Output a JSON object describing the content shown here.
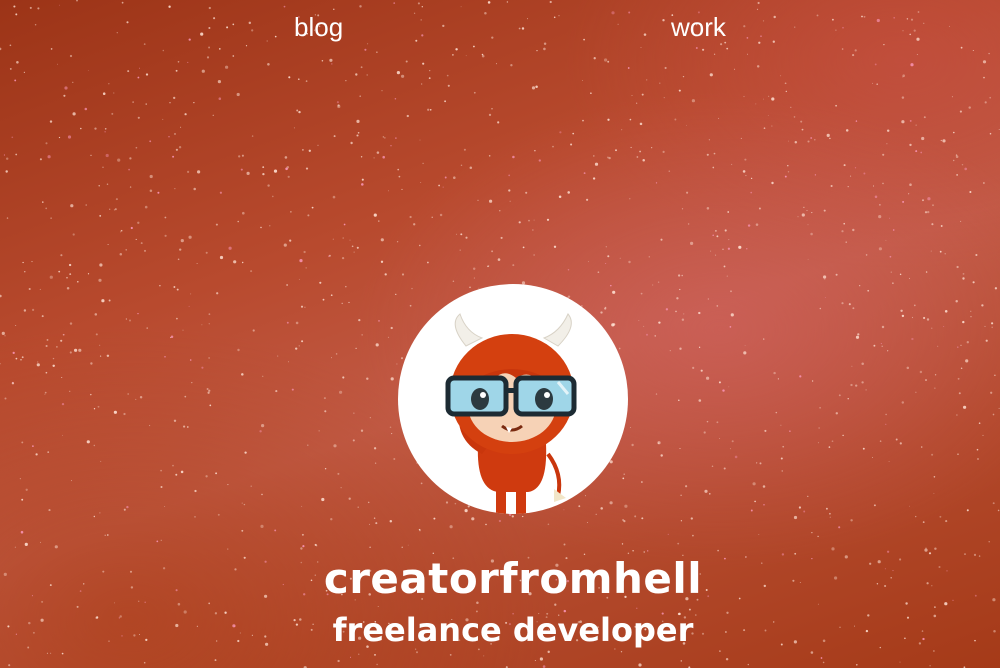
{
  "nav": {
    "blog_label": "blog",
    "work_label": "work"
  },
  "profile": {
    "name": "creatorfromhell",
    "role": "freelance developer",
    "avatar_icon": "devil-mascot-avatar-icon"
  },
  "colors": {
    "background": "#b5472c",
    "text": "#ffffff",
    "avatar_bg": "#ffffff",
    "mascot_body": "#cf3a0f"
  }
}
